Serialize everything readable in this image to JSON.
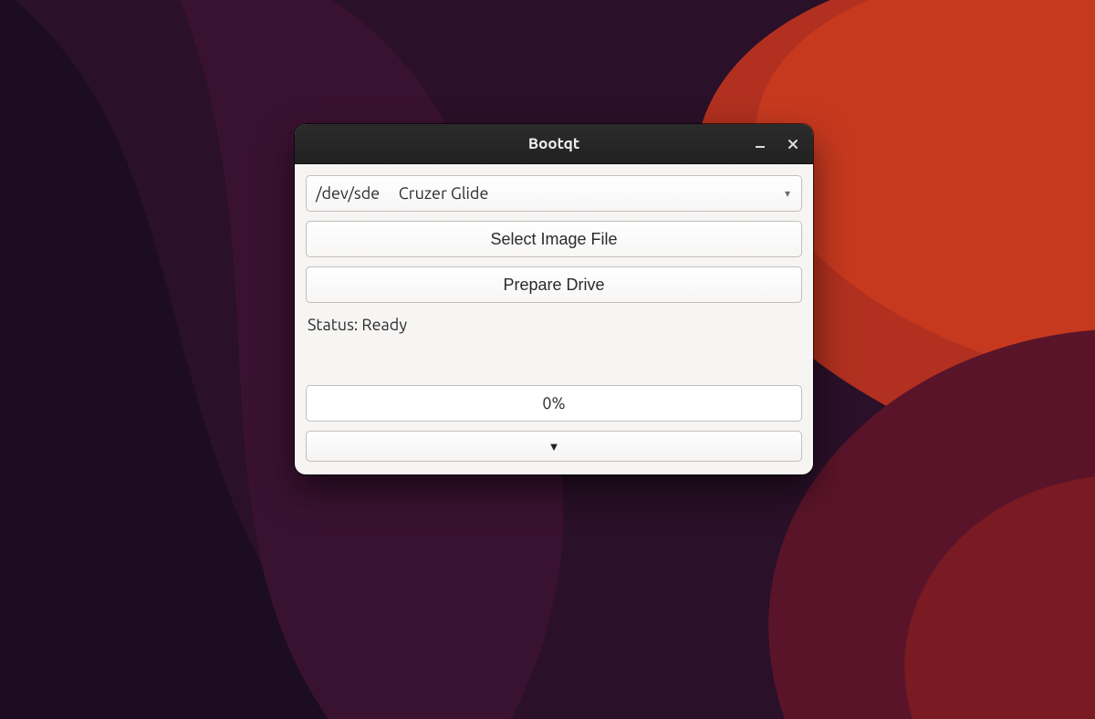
{
  "window": {
    "title": "Bootqt"
  },
  "drive_combo": {
    "selected": "/dev/sde     Cruzer Glide"
  },
  "buttons": {
    "select_image": "Select Image File",
    "prepare_drive": "Prepare Drive"
  },
  "status": {
    "text": "Status: Ready"
  },
  "progress": {
    "text": "0%",
    "value": 0
  },
  "expand": {
    "glyph": "▼"
  }
}
